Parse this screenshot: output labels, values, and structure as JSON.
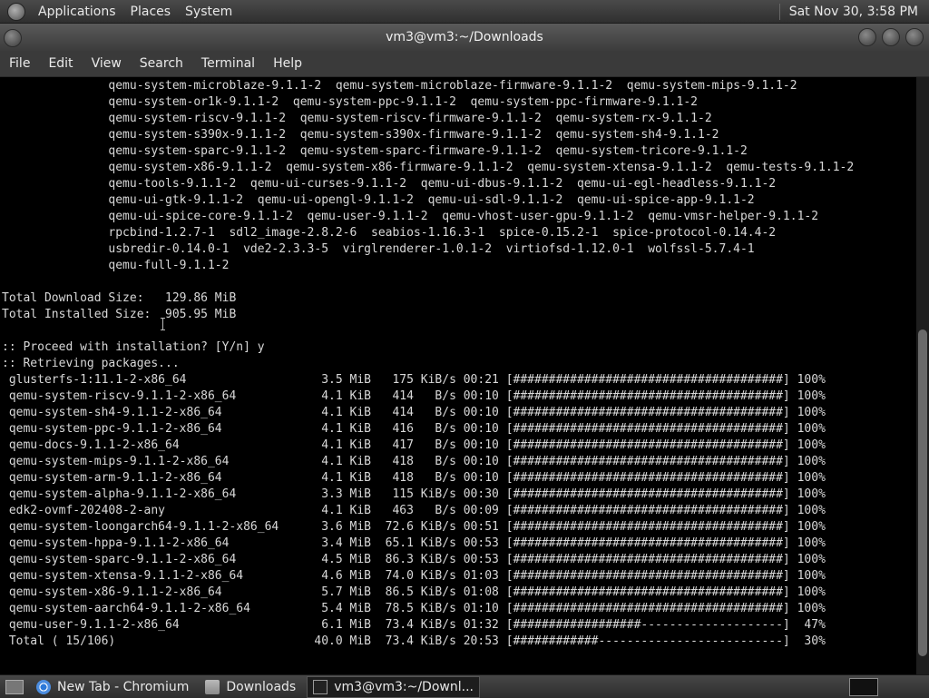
{
  "top_panel": {
    "menus": [
      "Applications",
      "Places",
      "System"
    ],
    "clock": "Sat Nov 30,  3:58 PM"
  },
  "window": {
    "title": "vm3@vm3:~/Downloads"
  },
  "menubar": [
    "File",
    "Edit",
    "View",
    "Search",
    "Terminal",
    "Help"
  ],
  "terminal": {
    "lines": [
      "               qemu-system-microblaze-9.1.1-2  qemu-system-microblaze-firmware-9.1.1-2  qemu-system-mips-9.1.1-2",
      "               qemu-system-or1k-9.1.1-2  qemu-system-ppc-9.1.1-2  qemu-system-ppc-firmware-9.1.1-2",
      "               qemu-system-riscv-9.1.1-2  qemu-system-riscv-firmware-9.1.1-2  qemu-system-rx-9.1.1-2",
      "               qemu-system-s390x-9.1.1-2  qemu-system-s390x-firmware-9.1.1-2  qemu-system-sh4-9.1.1-2",
      "               qemu-system-sparc-9.1.1-2  qemu-system-sparc-firmware-9.1.1-2  qemu-system-tricore-9.1.1-2",
      "               qemu-system-x86-9.1.1-2  qemu-system-x86-firmware-9.1.1-2  qemu-system-xtensa-9.1.1-2  qemu-tests-9.1.1-2",
      "               qemu-tools-9.1.1-2  qemu-ui-curses-9.1.1-2  qemu-ui-dbus-9.1.1-2  qemu-ui-egl-headless-9.1.1-2",
      "               qemu-ui-gtk-9.1.1-2  qemu-ui-opengl-9.1.1-2  qemu-ui-sdl-9.1.1-2  qemu-ui-spice-app-9.1.1-2",
      "               qemu-ui-spice-core-9.1.1-2  qemu-user-9.1.1-2  qemu-vhost-user-gpu-9.1.1-2  qemu-vmsr-helper-9.1.1-2",
      "               rpcbind-1.2.7-1  sdl2_image-2.8.2-6  seabios-1.16.3-1  spice-0.15.2-1  spice-protocol-0.14.4-2",
      "               usbredir-0.14.0-1  vde2-2.3.3-5  virglrenderer-1.0.1-2  virtiofsd-1.12.0-1  wolfssl-5.7.4-1",
      "               qemu-full-9.1.1-2",
      "",
      "Total Download Size:   129.86 MiB",
      "Total Installed Size:  905.95 MiB",
      "",
      ":: Proceed with installation? [Y/n] y",
      ":: Retrieving packages...",
      " glusterfs-1:11.1-2-x86_64                   3.5 MiB   175 KiB/s 00:21 [######################################] 100%",
      " qemu-system-riscv-9.1.1-2-x86_64            4.1 KiB   414   B/s 00:10 [######################################] 100%",
      " qemu-system-sh4-9.1.1-2-x86_64              4.1 KiB   414   B/s 00:10 [######################################] 100%",
      " qemu-system-ppc-9.1.1-2-x86_64              4.1 KiB   416   B/s 00:10 [######################################] 100%",
      " qemu-docs-9.1.1-2-x86_64                    4.1 KiB   417   B/s 00:10 [######################################] 100%",
      " qemu-system-mips-9.1.1-2-x86_64             4.1 KiB   418   B/s 00:10 [######################################] 100%",
      " qemu-system-arm-9.1.1-2-x86_64              4.1 KiB   418   B/s 00:10 [######################################] 100%",
      " qemu-system-alpha-9.1.1-2-x86_64            3.3 MiB   115 KiB/s 00:30 [######################################] 100%",
      " edk2-ovmf-202408-2-any                      4.1 KiB   463   B/s 00:09 [######################################] 100%",
      " qemu-system-loongarch64-9.1.1-2-x86_64      3.6 MiB  72.6 KiB/s 00:51 [######################################] 100%",
      " qemu-system-hppa-9.1.1-2-x86_64             3.4 MiB  65.1 KiB/s 00:53 [######################################] 100%",
      " qemu-system-sparc-9.1.1-2-x86_64            4.5 MiB  86.3 KiB/s 00:53 [######################################] 100%",
      " qemu-system-xtensa-9.1.1-2-x86_64           4.6 MiB  74.0 KiB/s 01:03 [######################################] 100%",
      " qemu-system-x86-9.1.1-2-x86_64              5.7 MiB  86.5 KiB/s 01:08 [######################################] 100%",
      " qemu-system-aarch64-9.1.1-2-x86_64          5.4 MiB  78.5 KiB/s 01:10 [######################################] 100%",
      " qemu-user-9.1.1-2-x86_64                    6.1 MiB  73.4 KiB/s 01:32 [##################--------------------]  47%",
      " Total ( 15/106)                            40.0 MiB  73.4 KiB/s 20:53 [############--------------------------]  30%"
    ]
  },
  "taskbar": {
    "tasks": [
      {
        "label": "New Tab - Chromium",
        "icon": "chromium-icon"
      },
      {
        "label": "Downloads",
        "icon": "folder-icon"
      },
      {
        "label": "vm3@vm3:~/Downl...",
        "icon": "terminal-icon"
      }
    ]
  }
}
